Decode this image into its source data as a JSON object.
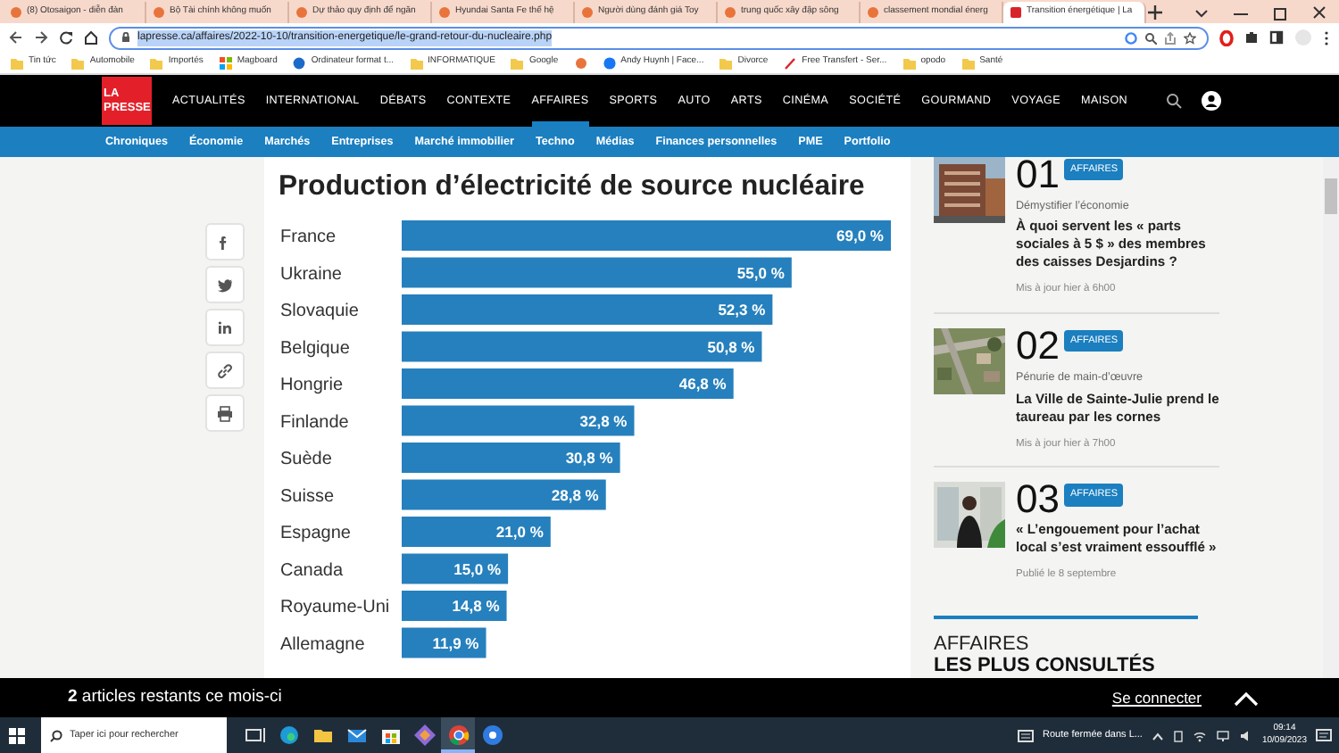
{
  "browser": {
    "tabs": [
      {
        "title": "(8) Otosaigon - diễn đàn",
        "selected": false
      },
      {
        "title": "Bộ Tài chính không muốn",
        "selected": false
      },
      {
        "title": "Dự thảo quy định để ngăn",
        "selected": false
      },
      {
        "title": "Hyundai Santa Fe thế hệ",
        "selected": false
      },
      {
        "title": "Người dùng đánh giá Toy",
        "selected": false
      },
      {
        "title": "trung quốc xây đập sông",
        "selected": false
      },
      {
        "title": "classement mondial énerg",
        "selected": false
      },
      {
        "title": "Transition énergétique | La",
        "selected": true
      }
    ],
    "url": "lapresse.ca/affaires/2022-10-10/transition-energetique/le-grand-retour-du-nucleaire.php",
    "bookmarks": [
      {
        "label": "Tin tức",
        "kind": "folder"
      },
      {
        "label": "Automobile",
        "kind": "folder"
      },
      {
        "label": "Importés",
        "kind": "folder"
      },
      {
        "label": "Magboard",
        "kind": "grid"
      },
      {
        "label": "Ordinateur format t...",
        "kind": "globe"
      },
      {
        "label": "INFORMATIQUE",
        "kind": "folder"
      },
      {
        "label": "Google",
        "kind": "folder"
      },
      {
        "kind": "site"
      },
      {
        "label": "Andy Huynh | Face...",
        "kind": "facebook"
      },
      {
        "label": "Divorce",
        "kind": "folder"
      },
      {
        "label": "Free Transfert - Ser...",
        "kind": "pen"
      },
      {
        "label": "opodo",
        "kind": "folder"
      },
      {
        "label": "Santé",
        "kind": "folder"
      }
    ]
  },
  "site": {
    "logo_top": "LA",
    "logo_bottom": "PRESSE",
    "nav": [
      {
        "label": "ACTUALITÉS",
        "selected": false
      },
      {
        "label": "INTERNATIONAL",
        "selected": false
      },
      {
        "label": "DÉBATS",
        "selected": false
      },
      {
        "label": "CONTEXTE",
        "selected": false
      },
      {
        "label": "AFFAIRES",
        "selected": true
      },
      {
        "label": "SPORTS",
        "selected": false
      },
      {
        "label": "AUTO",
        "selected": false
      },
      {
        "label": "ARTS",
        "selected": false
      },
      {
        "label": "CINÉMA",
        "selected": false
      },
      {
        "label": "SOCIÉTÉ",
        "selected": false
      },
      {
        "label": "GOURMAND",
        "selected": false
      },
      {
        "label": "VOYAGE",
        "selected": false
      },
      {
        "label": "MAISON",
        "selected": false
      }
    ],
    "subnav": [
      "Chroniques",
      "Économie",
      "Marchés",
      "Entreprises",
      "Marché immobilier",
      "Techno",
      "Médias",
      "Finances personnelles",
      "PME",
      "Portfolio"
    ]
  },
  "share_buttons": [
    {
      "kind": "facebook"
    },
    {
      "kind": "twitter"
    },
    {
      "kind": "linkedin"
    },
    {
      "kind": "link"
    },
    {
      "kind": "print"
    }
  ],
  "article": {
    "chart_data": {
      "type": "bar",
      "orientation": "horizontal",
      "title": "Production d’électricité de source nucléaire",
      "categories": [
        "France",
        "Ukraine",
        "Slovaquie",
        "Belgique",
        "Hongrie",
        "Finlande",
        "Suède",
        "Suisse",
        "Espagne",
        "Canada",
        "Royaume-Uni",
        "Allemagne"
      ],
      "values": [
        69.0,
        55.0,
        52.3,
        50.8,
        46.8,
        32.8,
        30.8,
        28.8,
        21.0,
        15.0,
        14.8,
        11.9
      ],
      "value_labels": [
        "69,0 %",
        "55,0 %",
        "52,3 %",
        "50,8 %",
        "46,8 %",
        "32,8 %",
        "30,8 %",
        "28,8 %",
        "21,0 %",
        "15,0 %",
        "14,8 %",
        "11,9 %"
      ],
      "data_labels": true
    }
  },
  "sidebar": {
    "items": [
      {
        "number": "01",
        "tag": "AFFAIRES",
        "kicker": "Démystifier l’économie",
        "title": "À quoi servent les « parts sociales à 5 $ » des membres des caisses Desjardins ?",
        "date": "Mis à jour hier à 6h00"
      },
      {
        "number": "02",
        "tag": "AFFAIRES",
        "kicker": "Pénurie de main-d’œuvre",
        "title": "La Ville de Sainte-Julie prend le taureau par les cornes",
        "date": "Mis à jour hier à 7h00"
      },
      {
        "number": "03",
        "tag": "AFFAIRES",
        "title": "« L’engouement pour l’achat local s’est vraiment essoufflé »",
        "date": "Publié le 8 septembre"
      }
    ],
    "section_title": "AFFAIRES",
    "section_subtitle": "LES PLUS CONSULTÉS"
  },
  "paywall_bar": {
    "text": "**2** articles restants ce mois-ci",
    "login": "Se connecter"
  },
  "taskbar": {
    "search_placeholder": "Taper ici pour rechercher",
    "apps": [
      {
        "kind": "taskview",
        "selected": false
      },
      {
        "kind": "edge",
        "selected": false
      },
      {
        "kind": "folder",
        "selected": false
      },
      {
        "kind": "mail",
        "selected": false
      },
      {
        "kind": "store",
        "selected": false
      },
      {
        "kind": "diamond",
        "selected": false
      },
      {
        "kind": "chrome",
        "selected": true
      },
      {
        "kind": "disc",
        "selected": false
      }
    ],
    "notification": "Route fermée dans L...",
    "time": "09:14",
    "date": "10/09/2023"
  }
}
